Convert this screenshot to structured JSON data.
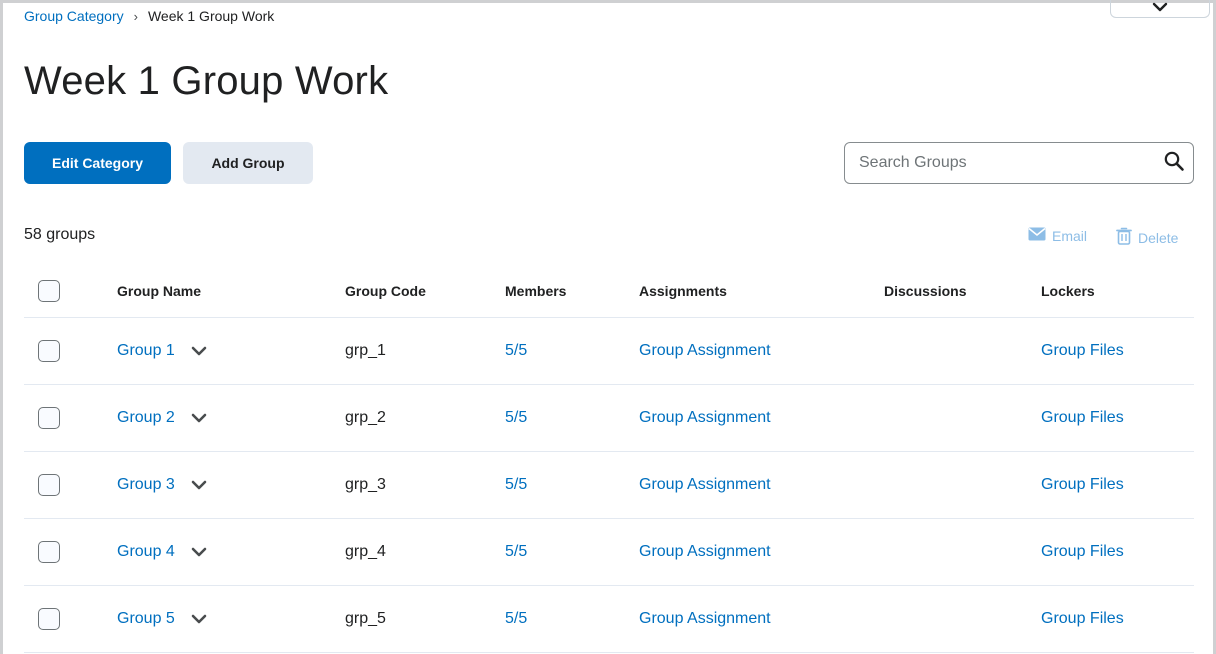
{
  "breadcrumb": {
    "parent": "Group Category",
    "separator": "›",
    "current": "Week 1 Group Work"
  },
  "page_title": "Week 1 Group Work",
  "buttons": {
    "edit_category": "Edit Category",
    "add_group": "Add Group"
  },
  "search": {
    "placeholder": "Search Groups",
    "value": ""
  },
  "group_count": "58 groups",
  "bulk_actions": {
    "email": "Email",
    "delete": "Delete"
  },
  "table": {
    "headers": [
      "Group Name",
      "Group Code",
      "Members",
      "Assignments",
      "Discussions",
      "Lockers"
    ],
    "rows": [
      {
        "name": "Group 1",
        "code": "grp_1",
        "members": "5/5",
        "assignment": "Group Assignment",
        "discussion": "",
        "locker": "Group Files"
      },
      {
        "name": "Group 2",
        "code": "grp_2",
        "members": "5/5",
        "assignment": "Group Assignment",
        "discussion": "",
        "locker": "Group Files"
      },
      {
        "name": "Group 3",
        "code": "grp_3",
        "members": "5/5",
        "assignment": "Group Assignment",
        "discussion": "",
        "locker": "Group Files"
      },
      {
        "name": "Group 4",
        "code": "grp_4",
        "members": "5/5",
        "assignment": "Group Assignment",
        "discussion": "",
        "locker": "Group Files"
      },
      {
        "name": "Group 5",
        "code": "grp_5",
        "members": "5/5",
        "assignment": "Group Assignment",
        "discussion": "",
        "locker": "Group Files"
      }
    ]
  },
  "colors": {
    "accent": "#006fbf",
    "secondary_button": "#e3e9f1",
    "disabled_action": "#8dbde6",
    "row_divider": "#e3e9f1"
  },
  "icons": {
    "breadcrumb_separator": "chevron-right-icon",
    "top_dropdown": "chevron-down-icon",
    "search": "search-icon",
    "email": "envelope-icon",
    "delete": "trash-icon",
    "row_menu": "chevron-down-icon"
  }
}
